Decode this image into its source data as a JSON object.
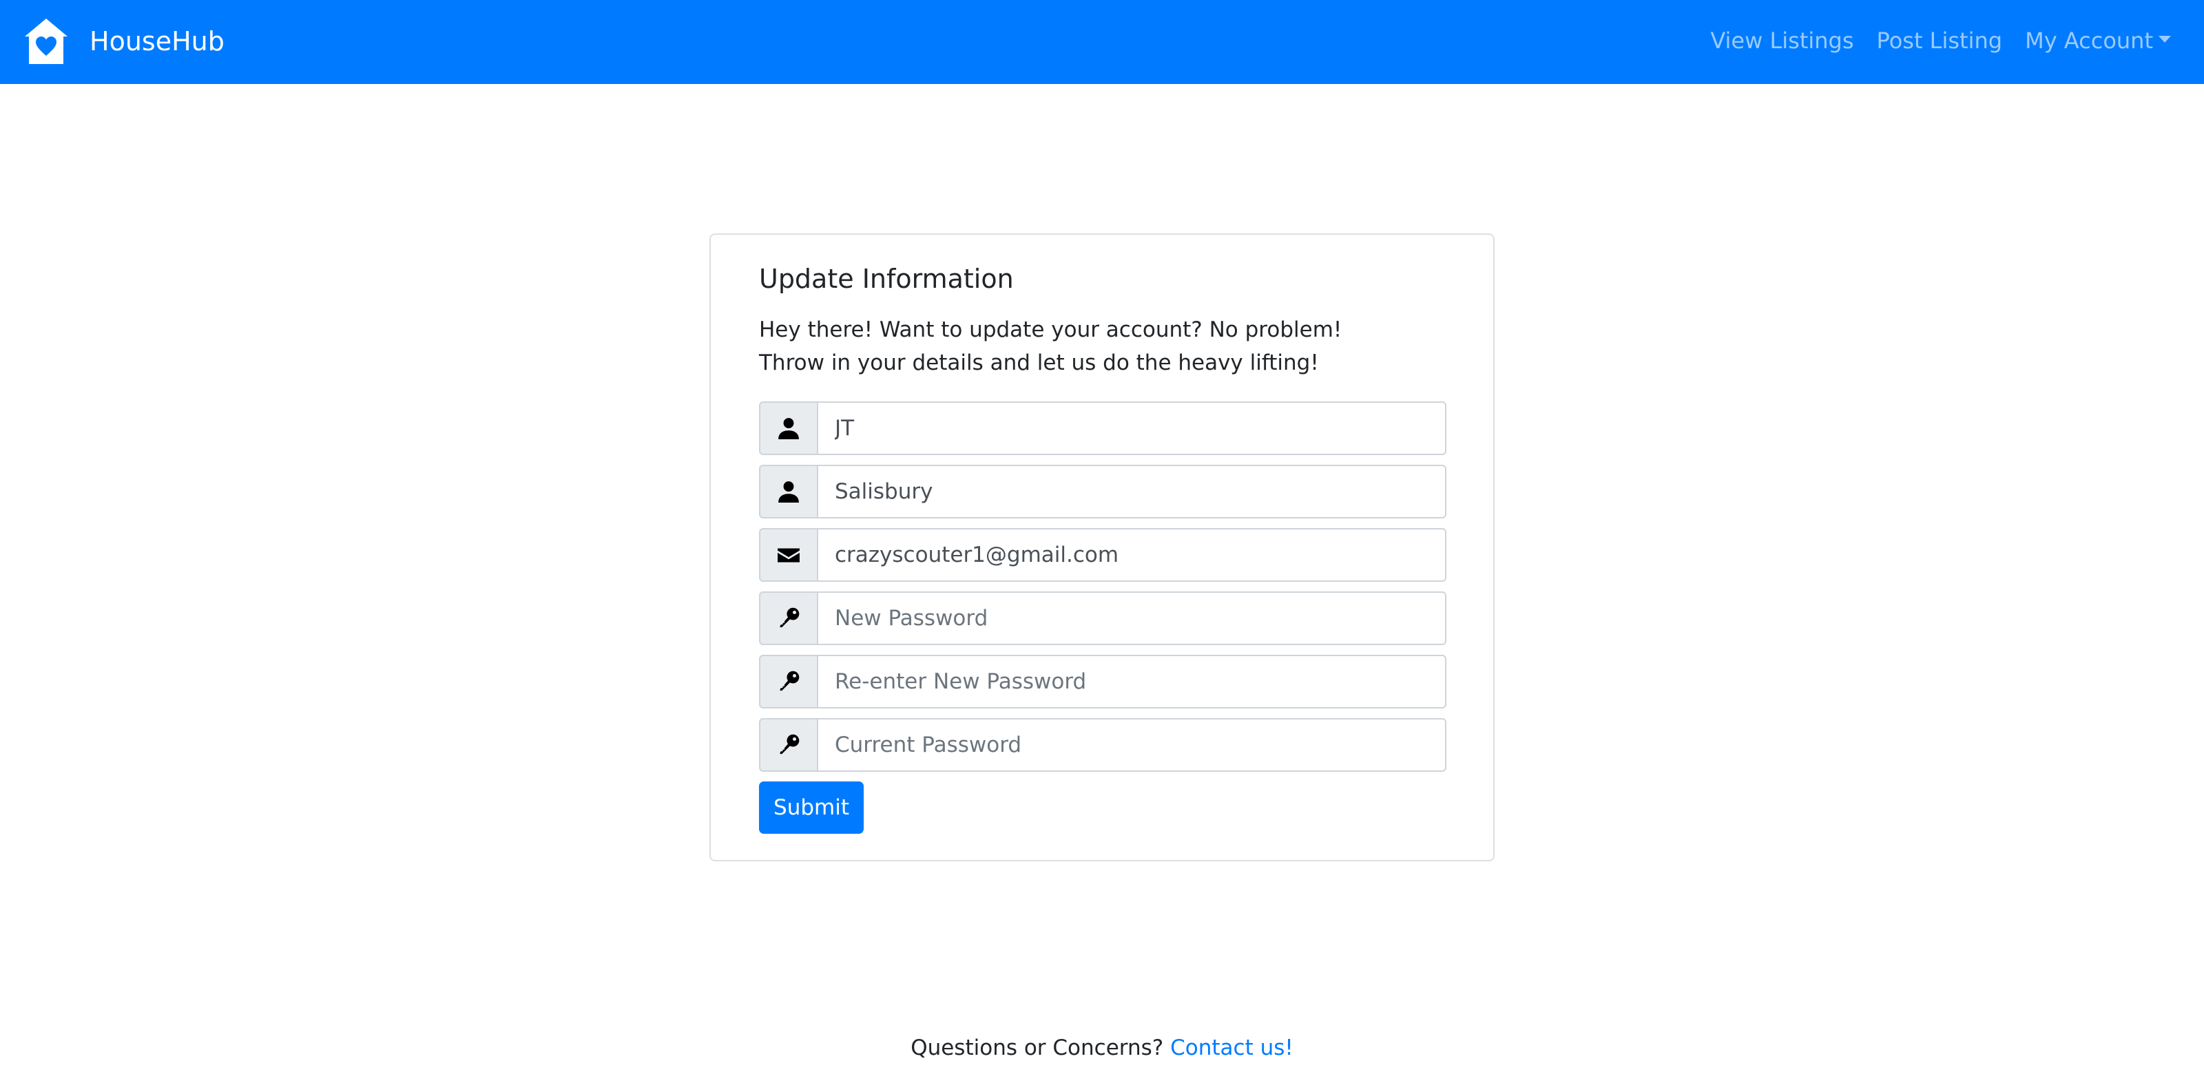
{
  "navbar": {
    "brand": "HouseHub",
    "logo_icon": "house-heart-icon",
    "links": {
      "view_listings": "View Listings",
      "post_listing": "Post Listing",
      "my_account": "My Account"
    },
    "colors": {
      "background": "#007bff",
      "link": "rgba(255,255,255,0.6)"
    }
  },
  "form": {
    "title": "Update Information",
    "description_line1": "Hey there! Want to update your account? No problem!",
    "description_line2": "Throw in your details and let us do the heavy lifting!",
    "fields": {
      "first_name": {
        "icon": "person-icon",
        "value": "JT",
        "placeholder": ""
      },
      "last_name": {
        "icon": "person-icon",
        "value": "Salisbury",
        "placeholder": ""
      },
      "email": {
        "icon": "envelope-icon",
        "value": "crazyscouter1@gmail.com",
        "placeholder": ""
      },
      "new_password": {
        "icon": "key-icon",
        "value": "",
        "placeholder": "New Password"
      },
      "confirm_password": {
        "icon": "key-icon",
        "value": "",
        "placeholder": "Re-enter New Password"
      },
      "current_password": {
        "icon": "key-icon",
        "value": "",
        "placeholder": "Current Password"
      }
    },
    "submit_label": "Submit"
  },
  "footer": {
    "text": "Questions or Concerns?",
    "link_text": "Contact us!"
  }
}
